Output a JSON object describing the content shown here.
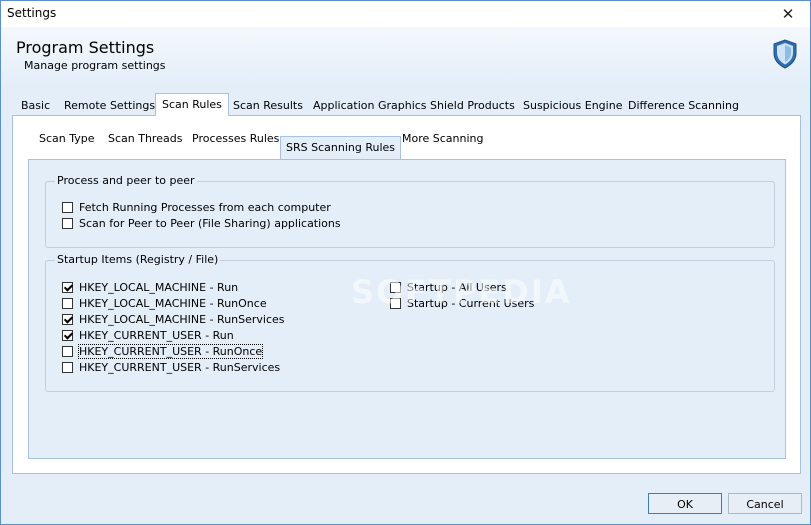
{
  "window": {
    "title": "Settings",
    "close_glyph": "✕"
  },
  "header": {
    "title": "Program Settings",
    "subtitle": "Manage program settings",
    "icon": "shield-icon"
  },
  "tabs": [
    "Basic",
    "Remote Settings",
    "Scan Rules",
    "Scan Results",
    "Application Graphics",
    "Shield Products",
    "Suspicious Engine",
    "Difference Scanning"
  ],
  "active_tab": "Scan Rules",
  "inner_tabs": [
    "Scan Type",
    "Scan Threads",
    "Processes Rules",
    "SRS Scanning Rules",
    "More Scanning"
  ],
  "active_inner_tab": "SRS Scanning Rules",
  "groups": {
    "process": {
      "legend": "Process and peer to peer",
      "items": [
        {
          "label": "Fetch Running Processes from each computer",
          "checked": false
        },
        {
          "label": "Scan for Peer to Peer (File Sharing) applications",
          "checked": false
        }
      ]
    },
    "startup": {
      "legend": "Startup Items (Registry / File)",
      "left": [
        {
          "label": "HKEY_LOCAL_MACHINE - Run",
          "checked": true
        },
        {
          "label": "HKEY_LOCAL_MACHINE - RunOnce",
          "checked": false
        },
        {
          "label": "HKEY_LOCAL_MACHINE - RunServices",
          "checked": true
        },
        {
          "label": "HKEY_CURRENT_USER - Run",
          "checked": true
        },
        {
          "label": "HKEY_CURRENT_USER - RunOnce",
          "checked": false
        },
        {
          "label": "HKEY_CURRENT_USER - RunServices",
          "checked": false
        }
      ],
      "right": [
        {
          "label": "Startup - All Users",
          "checked": false
        },
        {
          "label": "Startup - Current Users",
          "checked": false
        }
      ]
    }
  },
  "watermark": "SOFTPEDIA",
  "footer": {
    "ok_label": "OK",
    "cancel_label": "Cancel"
  },
  "colors": {
    "accent": "#3c7fb1",
    "panel_bg": "#e3eef9",
    "border": "#a9c2dc"
  }
}
